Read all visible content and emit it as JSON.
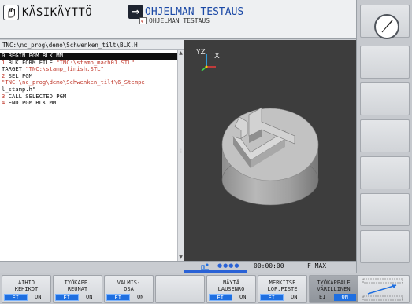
{
  "header": {
    "mode_left": "KÄSIKÄYTTÖ",
    "mode_right_title": "OHJELMAN TESTAUS",
    "mode_right_sub": "OHJELMAN TESTAUS"
  },
  "path": "TNC:\\nc_prog\\demo\\Schwenken_tilt\\BLK.H",
  "program": {
    "lines": [
      {
        "n": "0",
        "text": " BEGIN PGM BLK MM",
        "str": ""
      },
      {
        "n": "1",
        "text": " BLK FORM FILE ",
        "str": "\"TNC:\\stamp_mach01.STL\""
      },
      {
        "n": "",
        "text": "TARGET ",
        "str": "\"TNC:\\stamp_finish.STL\""
      },
      {
        "n": "2",
        "text": " SEL PGM",
        "str": ""
      },
      {
        "n": "",
        "text": "",
        "str": "\"TNC:\\nc_prog\\demo\\Schwenken_tilt\\6_Stempe"
      },
      {
        "n": "",
        "text": "l_stamp.h\"",
        "str": ""
      },
      {
        "n": "3",
        "text": " CALL SELECTED PGM",
        "str": ""
      },
      {
        "n": "4",
        "text": " END PGM BLK MM",
        "str": ""
      }
    ]
  },
  "graphic": {
    "axis_x": "X",
    "axis_yz": "YZ"
  },
  "status": {
    "time": "00:00:00",
    "feed": "F MAX"
  },
  "softkeys": [
    {
      "l1": "AIHIO",
      "l2": "KEHIKOT",
      "off": "EI",
      "on": "ON",
      "state": "off",
      "active": false
    },
    {
      "l1": "TYÖKAPP.",
      "l2": "REUNAT",
      "off": "EI",
      "on": "ON",
      "state": "off",
      "active": false
    },
    {
      "l1": "VALMIS-",
      "l2": "OSA",
      "off": "EI",
      "on": "ON",
      "state": "off",
      "active": false
    },
    {
      "l1": "",
      "l2": "",
      "off": "",
      "on": "",
      "state": "none",
      "active": false
    },
    {
      "l1": "NÄYTÄ",
      "l2": "LAUSENRO",
      "off": "EI",
      "on": "ON",
      "state": "off",
      "active": false
    },
    {
      "l1": "MERKITSE",
      "l2": "LOP.PISTE",
      "off": "EI",
      "on": "ON",
      "state": "off",
      "active": false
    },
    {
      "l1": "TYÖKAPPALE",
      "l2": "VÄRILLINEN",
      "off": "EI",
      "on": "ON",
      "state": "on",
      "active": true
    }
  ],
  "colors": {
    "accent": "#1f6fe0",
    "background": "#3d3d3d"
  }
}
